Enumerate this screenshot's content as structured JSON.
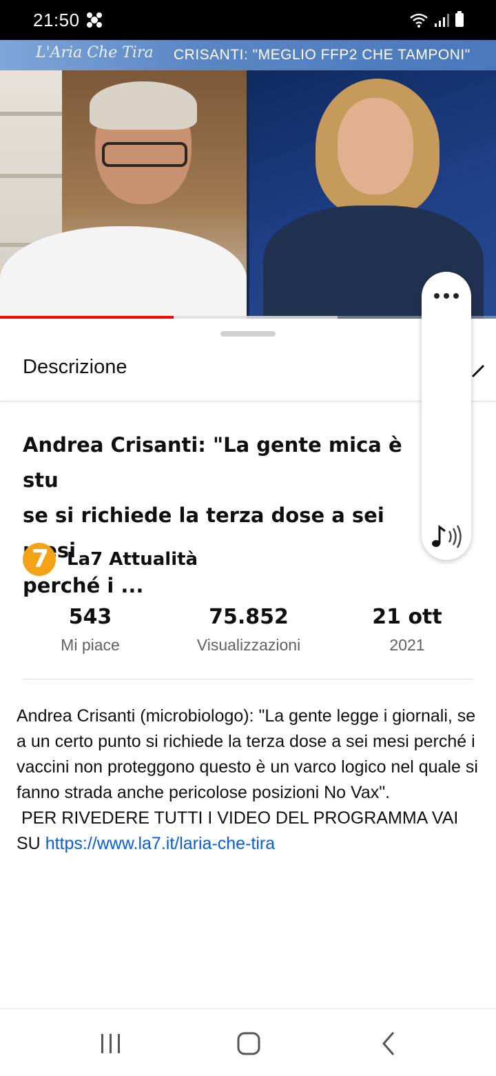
{
  "status_bar": {
    "time": "21:50",
    "icons": [
      "notification-icon",
      "wifi-icon",
      "signal-icon",
      "battery-icon"
    ]
  },
  "video": {
    "show_logo": "L'Aria Che Tira",
    "headline": "CRISANTI: \"MEGLIO FFP2 CHE TAMPONI\"",
    "progress_played": 0.35,
    "progress_buffered": 0.68
  },
  "sheet": {
    "title": "Descrizione",
    "video_title": "Andrea Crisanti: \"La gente mica è stu... se si richiede la terza dose a sei mesi perché i ...",
    "video_title_lines": [
      "Andrea Crisanti: \"La gente mica è stu",
      "se si richiede la terza dose a sei mesi",
      "perché i ..."
    ],
    "channel_name": "La7 Attualità",
    "avatar_text": "7",
    "stats": [
      {
        "value": "543",
        "label": "Mi piace"
      },
      {
        "value": "75.852",
        "label": "Visualizzazioni"
      },
      {
        "value": "21 ott",
        "label": "2021"
      }
    ],
    "description_text": "Andrea Crisanti (microbiologo): \"La gente legge i giornali, se a un certo punto si richiede la terza dose a sei mesi perché i vaccini non proteggono questo è un varco logico nel quale si fanno strada anche pericolose posizioni No Vax\".\n PER RIVEDERE TUTTI I VIDEO DEL PROGRAMMA VAI SU ",
    "description_link": "https://www.la7.it/laria-che-tira"
  },
  "colors": {
    "accent_red": "#ff0000",
    "link_blue": "#065fd4",
    "channel_orange": "#f5a316"
  }
}
